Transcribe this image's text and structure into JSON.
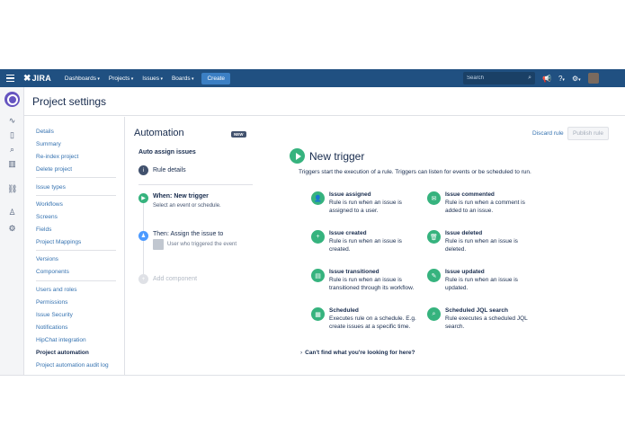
{
  "topnav": {
    "logo": "JIRA",
    "menus": [
      "Dashboards",
      "Projects",
      "Issues",
      "Boards"
    ],
    "create": "Create",
    "search_placeholder": "Search"
  },
  "header": {
    "title": "Project settings"
  },
  "settings_nav": {
    "group1": [
      "Details",
      "Summary",
      "Re-index project",
      "Delete project"
    ],
    "group2": [
      "Issue types"
    ],
    "group3": [
      "Workflows",
      "Screens",
      "Fields",
      "Project Mappings"
    ],
    "group4": [
      "Versions",
      "Components"
    ],
    "group5": [
      "Users and roles",
      "Permissions",
      "Issue Security",
      "Notifications",
      "HipChat integration",
      "Project automation",
      "Project automation audit log"
    ],
    "active": "Project automation"
  },
  "automation": {
    "title": "Automation",
    "badge": "NEW",
    "rule_name": "Auto assign issues",
    "rule_details": "Rule details",
    "when_title": "When: New trigger",
    "when_sub": "Select an event or schedule.",
    "then_title": "Then: Assign the issue to",
    "then_sub": "User who triggered the event",
    "add_component": "Add component"
  },
  "trigger_panel": {
    "discard": "Discard rule",
    "publish": "Publish rule",
    "title": "New trigger",
    "description": "Triggers start the execution of a rule. Triggers can listen for events or be scheduled to run.",
    "items": [
      {
        "title": "Issue assigned",
        "desc": "Rule is run when an issue is assigned to a user.",
        "icon": "user-icon"
      },
      {
        "title": "Issue commented",
        "desc": "Rule is run when a comment is added to an issue.",
        "icon": "comment-icon"
      },
      {
        "title": "Issue created",
        "desc": "Rule is run when an issue is created.",
        "icon": "plus-icon"
      },
      {
        "title": "Issue deleted",
        "desc": "Rule is run when an issue is deleted.",
        "icon": "trash-icon"
      },
      {
        "title": "Issue transitioned",
        "desc": "Rule is run when an issue is transitioned through its workflow.",
        "icon": "document-icon"
      },
      {
        "title": "Issue updated",
        "desc": "Rule is run when an issue is updated.",
        "icon": "pencil-icon"
      },
      {
        "title": "Scheduled",
        "desc": "Executes rule on a schedule. E.g. create issues at a specific time.",
        "icon": "calendar-icon"
      },
      {
        "title": "Scheduled JQL search",
        "desc": "Rule executes a scheduled JQL search.",
        "icon": "search-icon"
      }
    ],
    "cant_find": "Can't find what you're looking for here?"
  },
  "colors": {
    "nav_bg": "#205081",
    "accent_green": "#36b37e",
    "link": "#3572b0"
  }
}
